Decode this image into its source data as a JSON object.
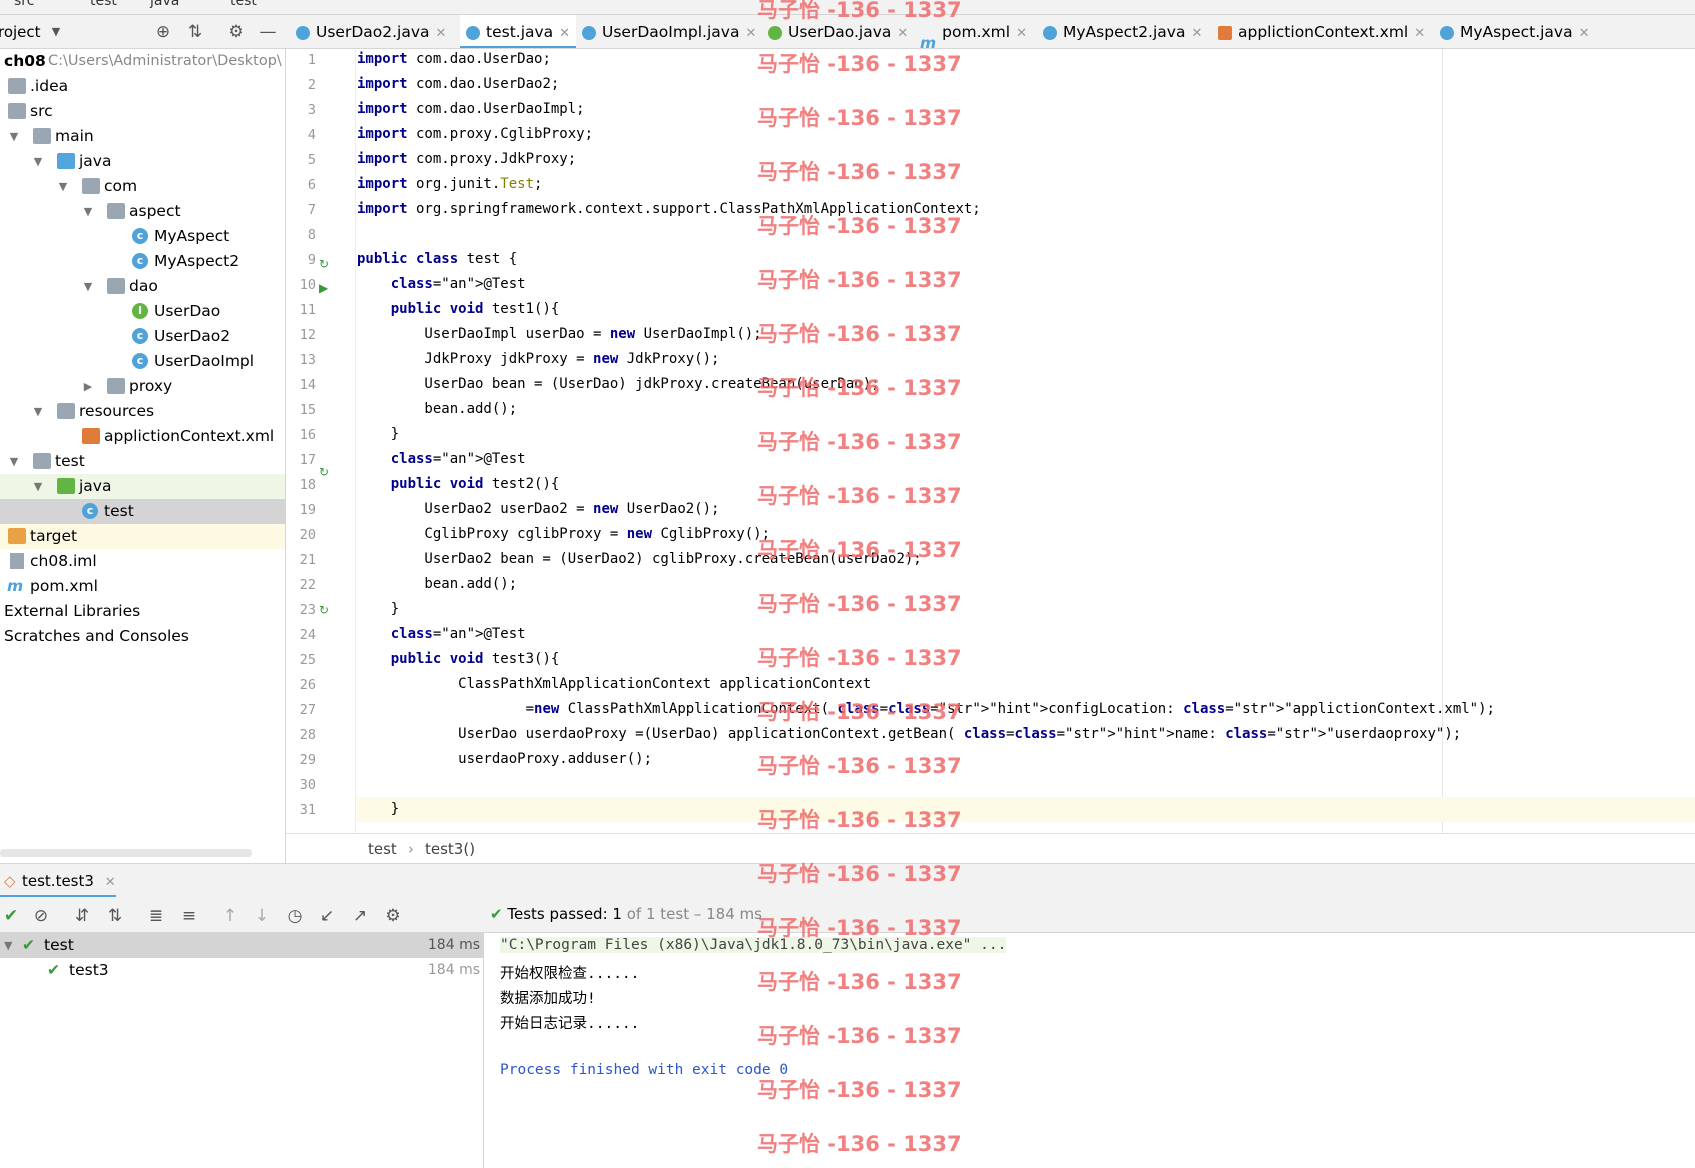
{
  "topbar": {
    "crumbs": [
      "src",
      "test",
      "java",
      "test"
    ]
  },
  "project_panel": {
    "title": "roject",
    "tree": [
      {
        "label": "ch08",
        "path": "C:\\Users\\Administrator\\Desktop\\",
        "icon": "module-folder-icon"
      },
      {
        "label": ".idea",
        "icon": "folder-icon"
      },
      {
        "label": "src",
        "icon": "folder-icon"
      },
      {
        "label": "main",
        "icon": "folder-icon"
      },
      {
        "label": "java",
        "icon": "source-folder-icon"
      },
      {
        "label": "com",
        "icon": "package-icon"
      },
      {
        "label": "aspect",
        "icon": "package-icon"
      },
      {
        "label": "MyAspect",
        "icon": "class-icon"
      },
      {
        "label": "MyAspect2",
        "icon": "class-icon"
      },
      {
        "label": "dao",
        "icon": "package-icon"
      },
      {
        "label": "UserDao",
        "icon": "interface-icon"
      },
      {
        "label": "UserDao2",
        "icon": "class-icon"
      },
      {
        "label": "UserDaoImpl",
        "icon": "class-icon"
      },
      {
        "label": "proxy",
        "icon": "package-icon"
      },
      {
        "label": "resources",
        "icon": "resources-folder-icon"
      },
      {
        "label": "applictionContext.xml",
        "icon": "spring-xml-icon"
      },
      {
        "label": "test",
        "icon": "folder-icon"
      },
      {
        "label": "java",
        "icon": "test-source-folder-icon"
      },
      {
        "label": "test",
        "icon": "test-class-icon"
      },
      {
        "label": "target",
        "icon": "excluded-folder-icon"
      },
      {
        "label": "ch08.iml",
        "icon": "iml-file-icon"
      },
      {
        "label": "pom.xml",
        "icon": "maven-icon"
      },
      {
        "label": "External Libraries",
        "icon": "library-icon"
      },
      {
        "label": "Scratches and Consoles",
        "icon": "scratches-icon"
      }
    ]
  },
  "editor": {
    "tabs": [
      {
        "label": "UserDao2.java",
        "icon": "class-icon"
      },
      {
        "label": "test.java",
        "icon": "test-class-icon",
        "active": true
      },
      {
        "label": "UserDaoImpl.java",
        "icon": "class-icon"
      },
      {
        "label": "UserDao.java",
        "icon": "interface-icon"
      },
      {
        "label": "pom.xml",
        "icon": "maven-icon"
      },
      {
        "label": "MyAspect2.java",
        "icon": "class-icon"
      },
      {
        "label": "applictionContext.xml",
        "icon": "spring-xml-icon"
      },
      {
        "label": "MyAspect.java",
        "icon": "class-icon"
      }
    ],
    "lines": [
      "import com.dao.UserDao;",
      "import com.dao.UserDao2;",
      "import com.dao.UserDaoImpl;",
      "import com.proxy.CglibProxy;",
      "import com.proxy.JdkProxy;",
      "import org.junit.Test;",
      "import org.springframework.context.support.ClassPathXmlApplicationContext;",
      "",
      "public class test {",
      "    @Test",
      "    public void test1(){",
      "        UserDaoImpl userDao = new UserDaoImpl();",
      "        JdkProxy jdkProxy = new JdkProxy();",
      "        UserDao bean = (UserDao) jdkProxy.createBean(userDao);",
      "        bean.add();",
      "    }",
      "    @Test",
      "    public void test2(){",
      "        UserDao2 userDao2 = new UserDao2();",
      "        CglibProxy cglibProxy = new CglibProxy();",
      "        UserDao2 bean = (UserDao2) cglibProxy.createBean(userDao2);",
      "        bean.add();",
      "    }",
      "    @Test",
      "    public void test3(){",
      "            ClassPathXmlApplicationContext applicationContext",
      "                    =new ClassPathXmlApplicationContext( configLocation: \"applictionContext.xml\");",
      "            UserDao userdaoProxy =(UserDao) applicationContext.getBean( name: \"userdaoproxy\");",
      "            userdaoProxy.adduser();",
      "",
      "    }"
    ],
    "breadcrumb": [
      "test",
      "test3()"
    ]
  },
  "run_panel": {
    "tab_label": "test.test3",
    "status_prefix": "Tests passed:",
    "status_count": "1",
    "status_rest": "of 1 test – 184 ms",
    "tests": [
      {
        "name": "test",
        "time": "184 ms"
      },
      {
        "name": "test3",
        "time": "184 ms"
      }
    ],
    "console": [
      "\"C:\\Program Files (x86)\\Java\\jdk1.8.0_73\\bin\\java.exe\" ...",
      "开始权限检查......",
      "数据添加成功!",
      "开始日志记录......",
      "",
      "Process finished with exit code 0"
    ]
  },
  "watermark": "马子怡 -136 - 1337",
  "colors": {
    "keyword": "#00008b",
    "annotation": "#808000",
    "string": "#067d17",
    "accent": "#4fa3d9",
    "watermark": "#f06a6a"
  }
}
